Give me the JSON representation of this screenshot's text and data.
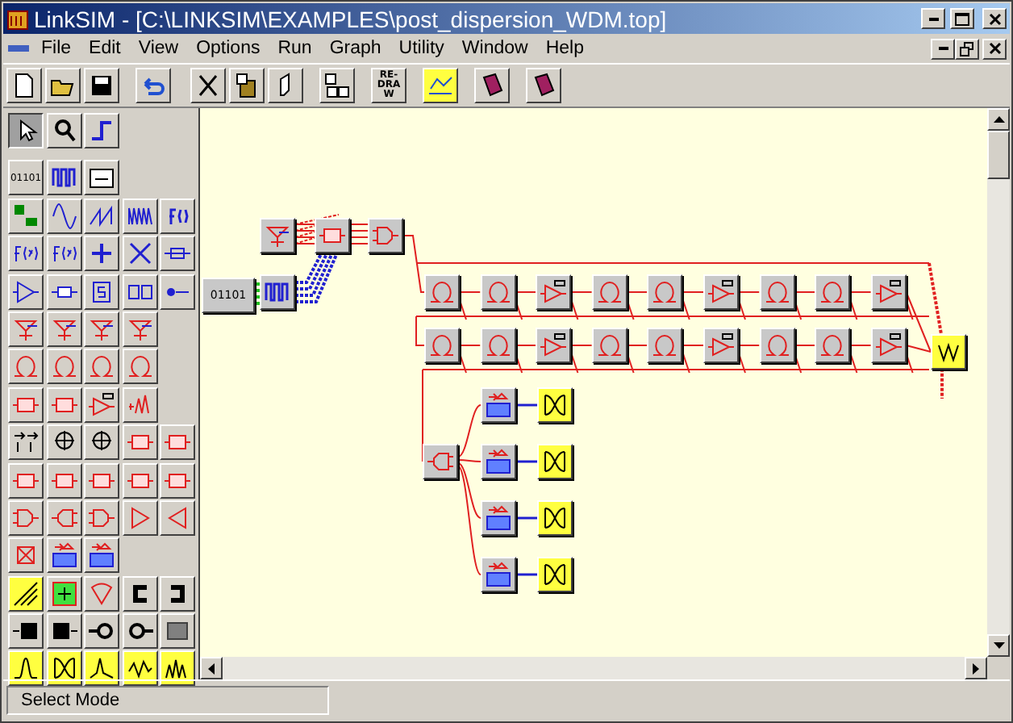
{
  "window": {
    "title": "LinkSIM - [C:\\LINKSIM\\EXAMPLES\\post_dispersion_WDM.top]"
  },
  "menu": [
    "File",
    "Edit",
    "View",
    "Options",
    "Run",
    "Graph",
    "Utility",
    "Window",
    "Help"
  ],
  "toolbar": [
    {
      "kind": "new"
    },
    {
      "kind": "open"
    },
    {
      "kind": "save"
    },
    {
      "kind": "undo"
    },
    {
      "kind": "cut"
    },
    {
      "kind": "paste"
    },
    {
      "kind": "move"
    },
    {
      "kind": "copy"
    },
    {
      "kind": "redraw",
      "label": "RE-DRAW"
    },
    {
      "kind": "chart"
    },
    {
      "kind": "book"
    },
    {
      "kind": "book"
    }
  ],
  "palette": {
    "tools": [
      {
        "kind": "pointer",
        "selected": true
      },
      {
        "kind": "zoom",
        "selected": false
      },
      {
        "kind": "wire",
        "selected": false
      }
    ],
    "data_label": "01101"
  },
  "canvas": {
    "transmitter": [
      {
        "kind": "data",
        "label": "01101"
      },
      {
        "kind": "pulse"
      },
      {
        "kind": "laser"
      },
      {
        "kind": "modulator"
      },
      {
        "kind": "mux"
      }
    ],
    "spans": [
      [
        {
          "kind": "fiber"
        },
        {
          "kind": "fiber"
        },
        {
          "kind": "edfa"
        },
        {
          "kind": "fiber"
        },
        {
          "kind": "fiber"
        },
        {
          "kind": "edfa"
        },
        {
          "kind": "fiber"
        },
        {
          "kind": "fiber"
        },
        {
          "kind": "edfa"
        }
      ],
      [
        {
          "kind": "fiber"
        },
        {
          "kind": "fiber"
        },
        {
          "kind": "edfa"
        },
        {
          "kind": "fiber"
        },
        {
          "kind": "fiber"
        },
        {
          "kind": "edfa"
        },
        {
          "kind": "fiber"
        },
        {
          "kind": "fiber"
        },
        {
          "kind": "edfa"
        }
      ]
    ],
    "monitor": {
      "kind": "scope"
    },
    "demux": {
      "kind": "demux"
    },
    "receivers": [
      {
        "kind": "receiver"
      },
      {
        "kind": "receiver"
      },
      {
        "kind": "receiver"
      },
      {
        "kind": "receiver"
      }
    ],
    "displays": [
      {
        "kind": "eye"
      },
      {
        "kind": "eye"
      },
      {
        "kind": "eye"
      },
      {
        "kind": "eye"
      }
    ]
  },
  "status_bar": {
    "text": "Select Mode"
  }
}
